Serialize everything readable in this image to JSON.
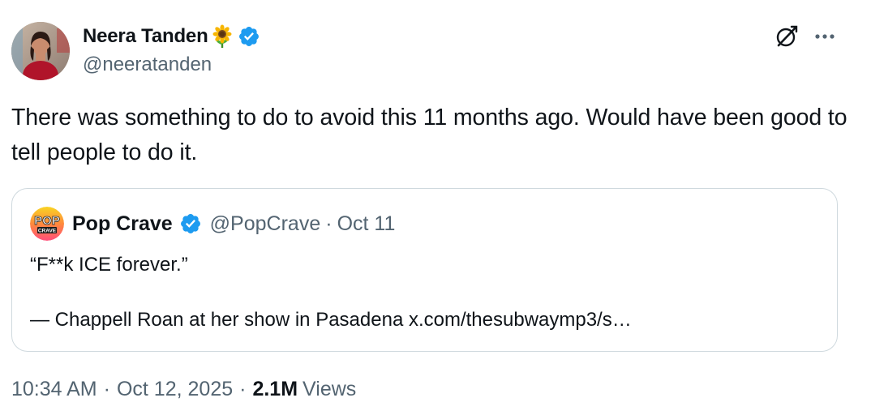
{
  "author": {
    "name": "Neera Tanden",
    "handle": "@neeratanden",
    "avatar_icon": "person-avatar",
    "name_emoji_icon": "sunflower-icon",
    "verified_color": "#1d9bf0"
  },
  "actions": {
    "grok_icon": "grok-icon",
    "more_icon": "more-icon"
  },
  "tweet": {
    "text": "There was something to do to avoid this 11 months ago. Would have been good to tell people to do it."
  },
  "quote": {
    "name": "Pop Crave",
    "handle": "@PopCrave",
    "separator": "·",
    "date": "Oct 11",
    "avatar_icon": "pop-crave-logo",
    "text_line1": "“F**k ICE forever.”",
    "text_line2": "— Chappell Roan at her show in Pasadena x.com/thesubwaymp3/s…"
  },
  "meta": {
    "time": "10:34 AM",
    "separator": "·",
    "date": "Oct 12, 2025",
    "views_count": "2.1M",
    "views_label": "Views"
  }
}
